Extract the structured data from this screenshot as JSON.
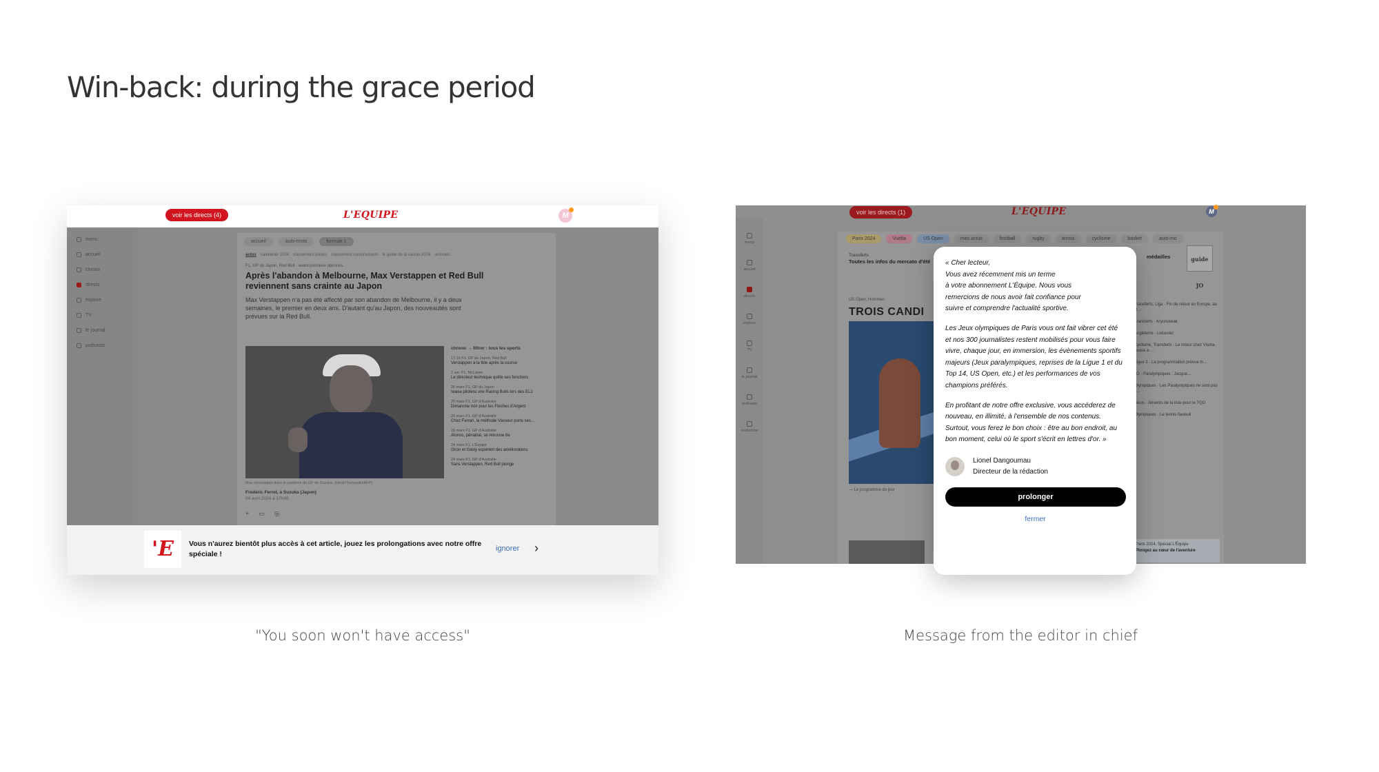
{
  "slide": {
    "title": "Win-back: during the grace period",
    "caption_left": "\"You soon won't have access\"",
    "caption_right": "Message from the editor in chief"
  },
  "left_screen": {
    "live_pill": "voir les directs (4)",
    "logo": "L'EQUIPE",
    "avatar_letter": "M",
    "nav": [
      "menu",
      "accueil",
      "chrono",
      "directs",
      "explore",
      "TV",
      "le journal",
      "podcasts"
    ],
    "tabs": [
      "accueil",
      "auto-moto",
      "formule 1"
    ],
    "subtabs": [
      "actus",
      "calendrier 2024",
      "classement pilotes",
      "classement constructeurs",
      "le guide de la saison 2024",
      "archives"
    ],
    "kicker": "F1, GP du Japon, Red Bull  ·  avant-première abonnés",
    "headline": "Après l'abandon à Melbourne, Max Verstappen et Red Bull reviennent sans crainte au Japon",
    "lede": "Max Verstappen n'a pas été affecté par son abandon de Melbourne, il y a deux semaines, le premier en deux ans. D'autant qu'au Japon, des nouveautés sont prévues sur la Red Bull.",
    "photo_credit": "Max Verstappen dans le paddock du GP de Suzuka. (Hiroki Yamazaki/AFP)",
    "byline_author": "Frédéric Ferret, à Suzuka (Japon)",
    "byline_date": "04 avril 2024 à 17h48",
    "chrono_head": "chrono  →  filtrer : tous les sports",
    "chrono_items": [
      {
        "meta": "17:16  F1, GP du Japon, Red Bull",
        "title": "Verstappen à la fête après la course"
      },
      {
        "meta": "2 avr.  F1, McLaren",
        "title": "Le directeur technique quitte ses fonctions"
      },
      {
        "meta": "26 mars  F1, GP du Japon",
        "title": "Iwasa pilotera une Racing Bulls lors des EL1"
      },
      {
        "meta": "26 mars  F1, GP d'Australie",
        "title": "Dimanche noir pour les Flèches d'Argent"
      },
      {
        "meta": "26 mars  F1, GP d'Australie",
        "title": "Chez Ferrari, la méthode Vasseur porte ses..."
      },
      {
        "meta": "26 mars  F1, GP d'Australie",
        "title": "Alonso, pénalisé, se retrouve 8e"
      },
      {
        "meta": "24 mars  F1, L'Équipe",
        "title": "Ocon et Gasly espèrent des améliorations"
      },
      {
        "meta": "24 mars  F1, GP d'Australie",
        "title": "Sans Verstappen, Red Bull plonge"
      }
    ],
    "banner_logo": "'E",
    "banner_text": "Vous n'aurez bientôt plus accès à cet article, jouez les prolongations avec notre offre spéciale !",
    "banner_ignore": "ignorer",
    "banner_chevron": "›"
  },
  "right_screen": {
    "live_pill": "voir les directs (1)",
    "logo": "L'EQUIPE",
    "avatar_letter": "M",
    "nav": [
      "menu",
      "accueil",
      "directs",
      "explore",
      "TV",
      "le journal",
      "podcasts",
      "recherche"
    ],
    "tabs": [
      "Paris 2024",
      "Vuelta",
      "US Open",
      "mes actus",
      "football",
      "rugby",
      "tennis",
      "cyclisme",
      "basket",
      "auto-mo"
    ],
    "transfer_kicker": "Transferts",
    "transfer_title": "Toutes les infos du mercato d'été",
    "medals": "médailles",
    "guide": "guide JO",
    "kicker": "US Open, Hommes",
    "headline": "TROIS CANDI",
    "photo_caption": "— Le programme du jour",
    "list": [
      "Transferts, Liga · Fin de retour en Europe, au R...",
      "Transferts · Krychowiak",
      "Angleterre · Leicester",
      "Cyclisme, Transferts · Le retour chez Visma-Lease a ...",
      "Ligue 2 · La programmation prévue m...",
      "JO · Paralympiques : Jacque...",
      "Olympiques · Les Paralympiques ne sont pas o...",
      "Bleus · Absents de la liste pour le TQO",
      "Olympiques · Le tennis fauteuil"
    ],
    "ad_kicker": "Paris 2024, Spécial L'Équipe",
    "ad_title": "Plongez au cœur de l'aventure"
  },
  "editor_modal": {
    "p1": [
      "« Cher lecteur,",
      "Vous avez récemment mis un terme",
      "à votre abonnement L'Équipe. Nous vous",
      "remercions de nous avoir fait confiance pour",
      "suivre et comprendre l'actualité sportive."
    ],
    "p2": "Les Jeux olympiques de Paris vous ont fait vibrer cet été et nos 300 journalistes restent mobilisés pour vous faire vivre, chaque jour, en immersion, les évènements sportifs majeurs (Jeux paralympiques, reprises de la Ligue 1 et du Top 14, US Open, etc.) et les performances de vos champions préférés.",
    "p3": "En profitant de notre offre exclusive, vous accéderez de nouveau, en illimité, à l'ensemble de nos contenus. Surtout, vous ferez le bon choix : être au bon endroit, au bon moment, celui où le sport s'écrit en lettres d'or. »",
    "signer_name": "Lionel Dangoumau",
    "signer_role": "Directeur de la rédaction",
    "cta_label": "prolonger",
    "close_label": "fermer"
  }
}
